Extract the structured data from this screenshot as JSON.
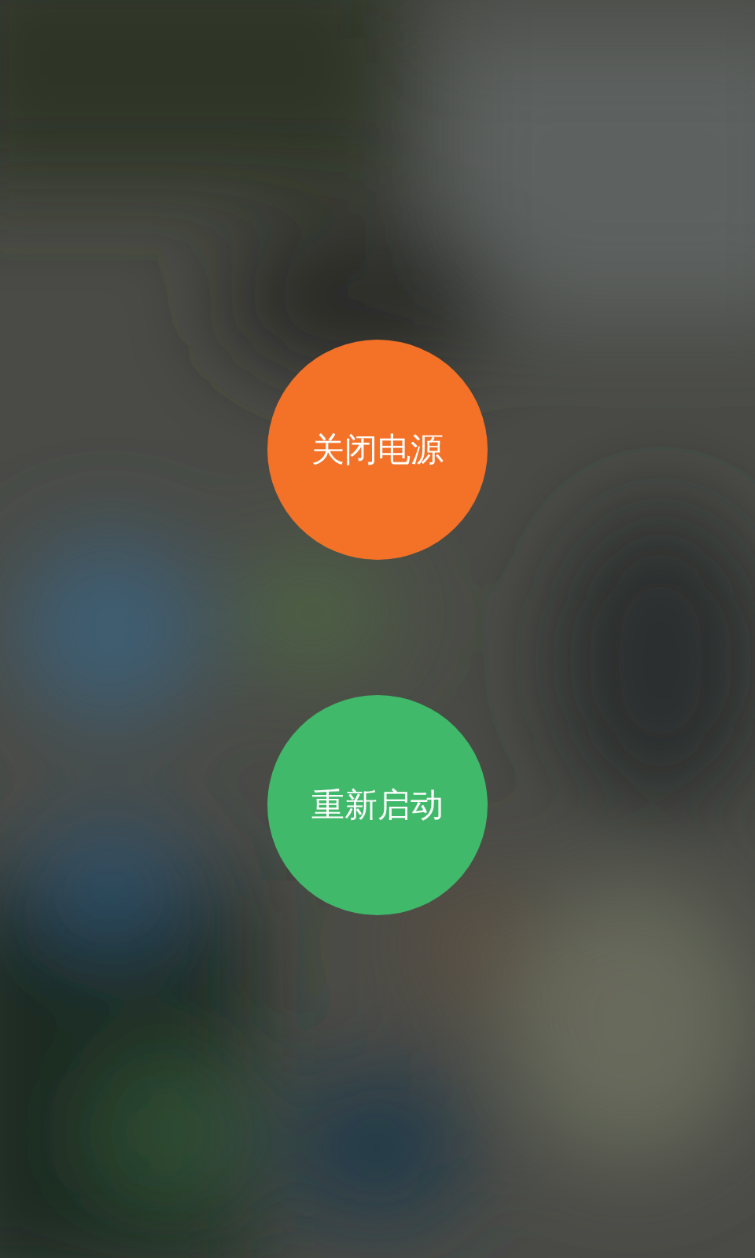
{
  "buttons": [
    {
      "label": "关闭电源",
      "kind": "power-off"
    },
    {
      "label": "重新启动",
      "kind": "restart"
    }
  ]
}
